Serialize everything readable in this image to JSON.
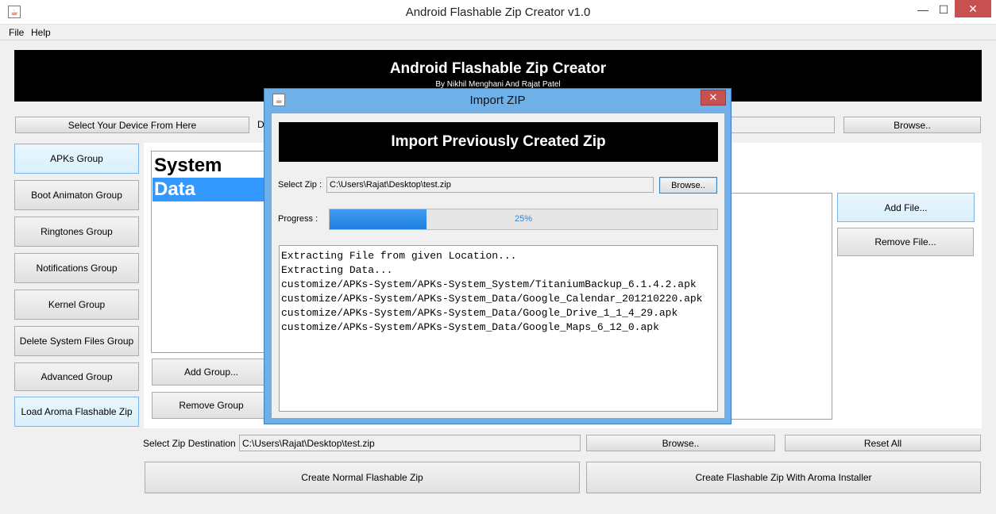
{
  "window": {
    "title": "Android Flashable Zip Creator v1.0",
    "controls": {
      "minimize": "—",
      "maximize": "☐",
      "close": "✕"
    }
  },
  "menu": [
    "File",
    "Help"
  ],
  "banner": {
    "title": "Android Flashable Zip Creator",
    "subtitle": "By Nikhil Menghani And Rajat Patel"
  },
  "device": {
    "select_button": "Select Your Device From Here",
    "label_fragment": "D",
    "browse_button": "Browse.."
  },
  "groups": [
    "APKs Group",
    "Boot Animaton Group",
    "Ringtones Group",
    "Notifications Group",
    "Kernel Group",
    "Delete System Files Group",
    "Advanced Group",
    "Load Aroma Flashable Zip"
  ],
  "group_list": {
    "items": [
      "System",
      "Data"
    ],
    "selected_index": 1,
    "add_button": "Add Group...",
    "remove_button": "Remove Group"
  },
  "file_actions": {
    "add": "Add File...",
    "remove": "Remove File..."
  },
  "destination": {
    "label": "Select Zip Destination :",
    "value": "C:\\Users\\Rajat\\Desktop\\test.zip",
    "browse": "Browse..",
    "reset": "Reset All"
  },
  "create": {
    "normal": "Create Normal Flashable Zip",
    "aroma": "Create Flashable Zip With Aroma Installer"
  },
  "dialog": {
    "title": "Import ZIP",
    "close": "✕",
    "header": "Import Previously Created Zip",
    "select_label": "Select Zip :",
    "select_value": "C:\\Users\\Rajat\\Desktop\\test.zip",
    "browse": "Browse..",
    "progress_label": "Progress :",
    "progress_value": 0.25,
    "progress_text": "25%",
    "log": [
      "Extracting File from given Location...",
      "Extracting Data...",
      "customize/APKs-System/APKs-System_System/TitaniumBackup_6.1.4.2.apk",
      "customize/APKs-System/APKs-System_Data/Google_Calendar_201210220.apk",
      "customize/APKs-System/APKs-System_Data/Google_Drive_1_1_4_29.apk",
      "customize/APKs-System/APKs-System_Data/Google_Maps_6_12_0.apk"
    ]
  }
}
